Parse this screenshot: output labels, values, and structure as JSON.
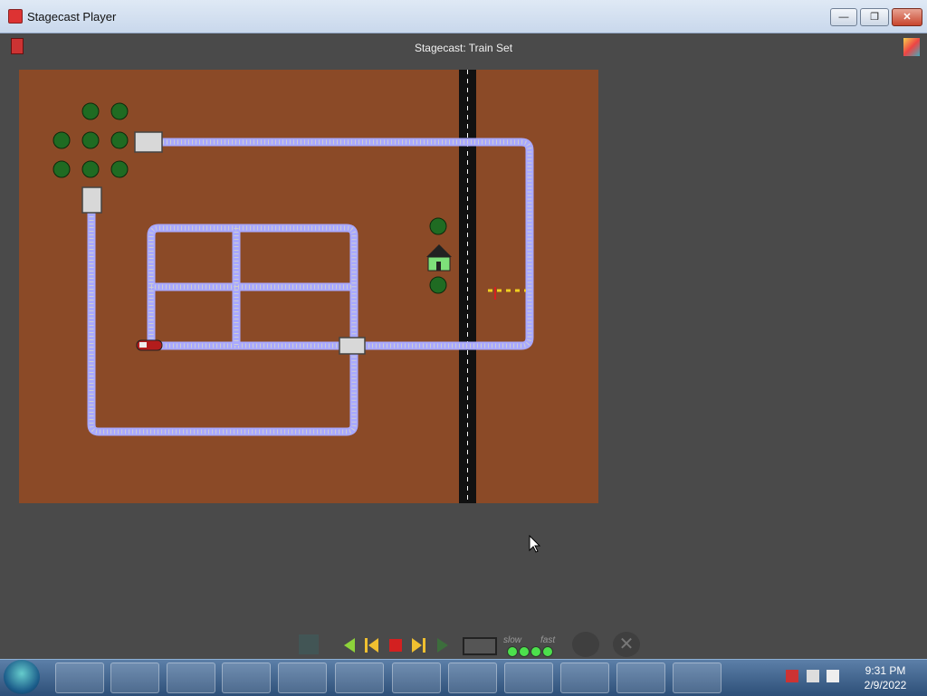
{
  "window": {
    "title": "Stagecast Player",
    "controls": [
      "minimize",
      "restore",
      "close"
    ]
  },
  "stage": {
    "title": "Stagecast: Train Set"
  },
  "playback": {
    "speed_slow_label": "slow",
    "speed_fast_label": "fast",
    "speed_level": 4,
    "speed_levels": 4
  },
  "taskbar": {
    "items": [
      "file-explorer",
      "media-player",
      "chrome",
      "rabbit-app",
      "cross-app",
      "oscilloscope-app",
      "command-prompt",
      "cross-puzzle-app",
      "gem-app",
      "notes-app",
      "help-app",
      "java-app"
    ],
    "clock": {
      "time": "9:31 PM",
      "date": "2/9/2022"
    }
  },
  "colors": {
    "board": "#8b4a27",
    "track": "#a9a9ff",
    "road": "#111111"
  }
}
